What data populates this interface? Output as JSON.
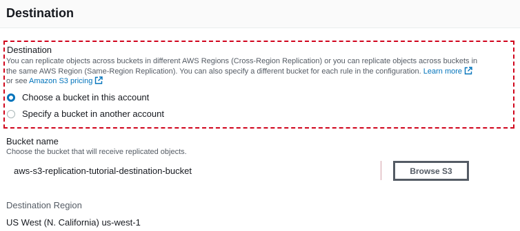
{
  "section": {
    "title": "Destination"
  },
  "destination": {
    "label": "Destination",
    "description_line1": "You can replicate objects across buckets in different AWS Regions (Cross-Region Replication) or you can replicate objects across buckets in",
    "description_line2": "the same AWS Region (Same-Region Replication). You can also specify a different bucket for each rule in the configuration.",
    "learn_more": "Learn more",
    "or_see": "or see",
    "pricing_link": "Amazon S3 pricing",
    "options": [
      {
        "label": "Choose a bucket in this account",
        "selected": true
      },
      {
        "label": "Specify a bucket in another account",
        "selected": false
      }
    ]
  },
  "bucket": {
    "label": "Bucket name",
    "hint": "Choose the bucket that will receive replicated objects.",
    "value": "aws-s3-replication-tutorial-destination-bucket",
    "browse_label": "Browse S3"
  },
  "region": {
    "label": "Destination Region",
    "value": "US West (N. California) us-west-1"
  },
  "colors": {
    "link": "#0073bb",
    "highlight_border": "#d0021b",
    "radio_selected": "#0073bb"
  }
}
